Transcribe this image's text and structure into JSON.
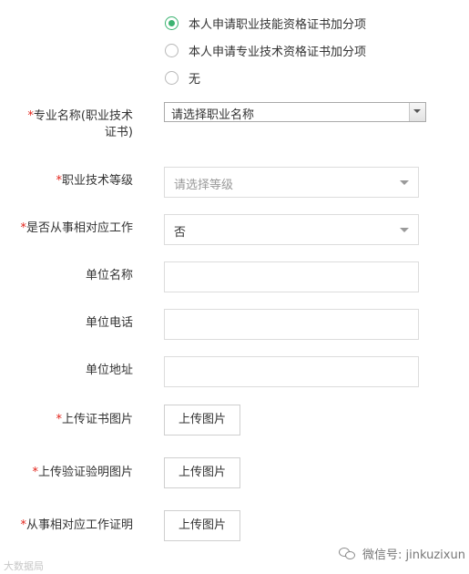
{
  "apply_options": [
    {
      "label": "本人申请职业技能资格证书加分项",
      "checked": true
    },
    {
      "label": "本人申请专业技术资格证书加分项",
      "checked": false
    },
    {
      "label": "无",
      "checked": false
    }
  ],
  "fields": {
    "major_name": {
      "label_line1": "专业名称(职业技术",
      "label_line2": "证书)",
      "value": "请选择职业名称"
    },
    "tech_level": {
      "label": "职业技术等级",
      "placeholder": "请选择等级"
    },
    "engaged_work": {
      "label": "是否从事相对应工作",
      "value": "否"
    },
    "unit_name": {
      "label": "单位名称",
      "value": ""
    },
    "unit_phone": {
      "label": "单位电话",
      "value": ""
    },
    "unit_address": {
      "label": "单位地址",
      "value": ""
    }
  },
  "uploads": {
    "certificate": {
      "label": "上传证书图片",
      "button": "上传图片"
    },
    "verification": {
      "label": "上传验证验明图片",
      "button": "上传图片"
    },
    "work_proof": {
      "label": "从事相对应工作证明",
      "button": "上传图片"
    }
  },
  "required_mark": "*",
  "footer": {
    "left_text": "大数据局",
    "wechat_text": "微信号: jinkuzixun"
  },
  "colors": {
    "required": "#e2231a",
    "radio_checked": "#3cb371",
    "border": "#dcdcdc"
  }
}
